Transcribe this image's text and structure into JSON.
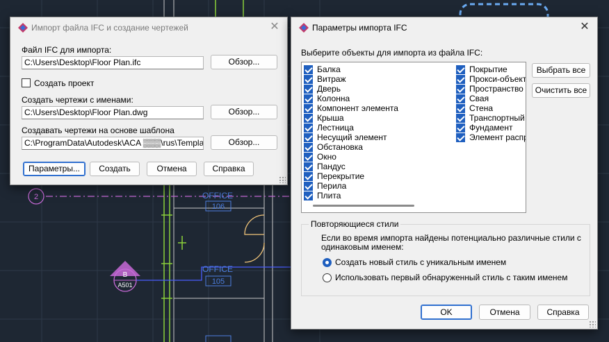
{
  "cad": {
    "room1_name": "OFFICE",
    "room1_num": "106",
    "room2_name": "OFFICE",
    "room2_num": "105",
    "grid_label": "2",
    "tag_top": "B",
    "tag_bottom": "A501"
  },
  "dlg1": {
    "title": "Импорт файла IFC и создание чертежей",
    "ifc_label": "Файл IFC для импорта:",
    "ifc_value": "C:\\Users\\Desktop\\Floor Plan.ifc",
    "browse1": "Обзор...",
    "create_project": "Создать проект",
    "names_label": "Создать чертежи с именами:",
    "names_value": "C:\\Users\\Desktop\\Floor Plan.dwg",
    "browse2": "Обзор...",
    "template_label": "Создавать чертежи на основе шаблона",
    "template_value": "C:\\ProgramData\\Autodesk\\ACA ▒▒▒\\rus\\Template\\A",
    "browse3": "Обзор...",
    "btn_params": "Параметры...",
    "btn_create": "Создать",
    "btn_cancel": "Отмена",
    "btn_help": "Справка"
  },
  "dlg2": {
    "title": "Параметры импорта IFC",
    "select_label": "Выберите объекты для импорта из файла IFC:",
    "col1": [
      "Балка",
      "Витраж",
      "Дверь",
      "Колонна",
      "Компонент элемента",
      "Крыша",
      "Лестница",
      "Несущий элемент",
      "Обстановка",
      "Окно",
      "Пандус",
      "Перекрытие",
      "Перила",
      "Плита"
    ],
    "col2": [
      "Покрытие",
      "Прокси-объект д",
      "Пространство",
      "Свая",
      "Стена",
      "Транспортный э.",
      "Фундамент",
      "Элемент распре."
    ],
    "select_all": "Выбрать все",
    "clear_all": "Очистить все",
    "group_title": "Повторяющиеся стили",
    "group_text1": "Если во время импорта найдены потенциально различные стили с",
    "group_text2": "одинаковым именем:",
    "radio1": "Создать новый стиль с уникальным именем",
    "radio2": "Использовать первый обнаруженный стиль с таким именем",
    "ok": "OK",
    "cancel": "Отмена",
    "help": "Справка"
  }
}
